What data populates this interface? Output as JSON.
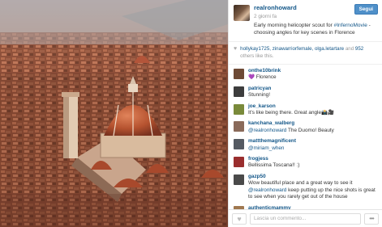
{
  "post": {
    "username": "realronhoward",
    "time": "2 giorni fa",
    "follow_label": "Segui",
    "caption_text": "Early morning helicopter scout for ",
    "caption_hashtag": "#InfernoMovie",
    "caption_rest": " - choosing angles for key scenes in Florence"
  },
  "likes": {
    "names": "hollykay1725, zinawarriorfemale, olga.letartare",
    "and_label": " and ",
    "count": "952",
    "others_label": " others like this."
  },
  "comments": [
    {
      "user": "onthe10brink",
      "text": "💜 Florence",
      "avatar_color": "#6e4a35"
    },
    {
      "user": "patricyan",
      "text": "Stunning!",
      "avatar_color": "#3d3d3d"
    },
    {
      "user": "joe_karson",
      "text": "It's like being there. Great angle📸🎥",
      "avatar_color": "#7a8a3a"
    },
    {
      "user": "kanchana_walberg",
      "mention": "@realronhoward",
      "text": " The Duomo! Beauty",
      "avatar_color": "#8a6a5a"
    },
    {
      "user": "mattthemagnificent",
      "mention": "@miriam_when",
      "text": "",
      "avatar_color": "#555a62"
    },
    {
      "user": "frogjess",
      "text": "Bellissima Toscana!! :)",
      "avatar_color": "#9a2e2e"
    },
    {
      "user": "gazp50",
      "text": "Wow beautiful place and a great way to see it ",
      "mention": "@realronhoward",
      "text2": " keep putting up the nice shots is great to see when you rarely get out of the house",
      "avatar_color": "#4a4a4a"
    },
    {
      "user": "authenticmammy",
      "text": "",
      "avatar_color": "#a07850"
    }
  ],
  "footer": {
    "comment_placeholder": "Lascia un commento...",
    "like_icon": "heart-icon",
    "more_label": "•••"
  },
  "colors": {
    "link_blue": "#125688",
    "follow_blue": "#4f90c9"
  }
}
